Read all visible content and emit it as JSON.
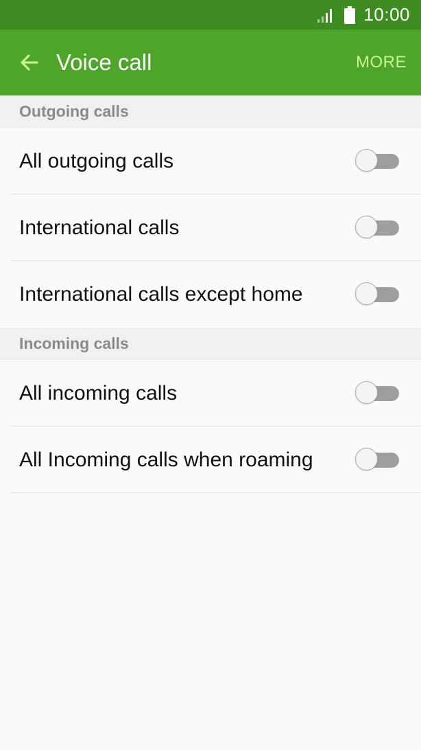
{
  "status_bar": {
    "time": "10:00",
    "icons": [
      "signal-icon",
      "battery-icon"
    ]
  },
  "app_bar": {
    "title": "Voice call",
    "more_label": "MORE",
    "back_icon": "arrow-left-icon",
    "colors": {
      "status_bar_bg": "#3e8b22",
      "app_bar_bg": "#4da62a",
      "more_text": "#c8f59a"
    }
  },
  "sections": [
    {
      "header": "Outgoing calls",
      "items": [
        {
          "label": "All outgoing calls",
          "enabled": false
        },
        {
          "label": "International calls",
          "enabled": false
        },
        {
          "label": "International calls except home",
          "enabled": false
        }
      ]
    },
    {
      "header": "Incoming calls",
      "items": [
        {
          "label": "All incoming calls",
          "enabled": false
        },
        {
          "label": "All Incoming calls when roaming",
          "enabled": false
        }
      ]
    }
  ]
}
